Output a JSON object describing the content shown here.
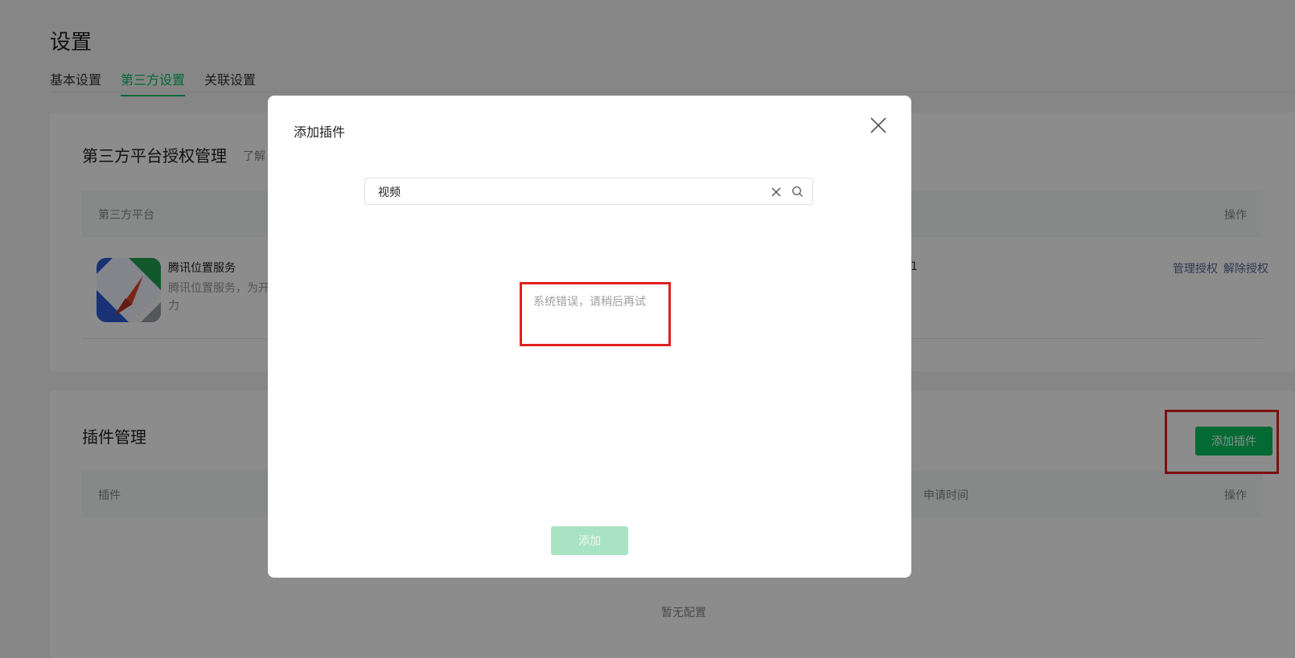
{
  "page": {
    "title": "设置",
    "tabs": [
      "基本设置",
      "第三方设置",
      "关联设置"
    ]
  },
  "third_party": {
    "title": "第三方平台授权管理",
    "learn_more": "了解",
    "col_platform": "第三方平台",
    "col_action": "操作",
    "service": {
      "name": "腾讯位置服务",
      "desc_line1": "腾讯位置服务，为开",
      "desc_line2": "力",
      "partial_value": "1",
      "manage_link": "管理授权",
      "revoke_link": "解除授权"
    }
  },
  "plugins": {
    "title": "插件管理",
    "add_button": "添加插件",
    "col_plugin": "插件",
    "col_apply_time": "申请时间",
    "col_action": "操作",
    "empty_text": "暂无配置"
  },
  "dialog": {
    "title": "添加插件",
    "search_value": "视频",
    "error_text": "系统错误，请稍后再试",
    "add_button": "添加"
  },
  "colors": {
    "accent": "#07c160",
    "link": "#576b95",
    "annotation": "#e02020"
  }
}
